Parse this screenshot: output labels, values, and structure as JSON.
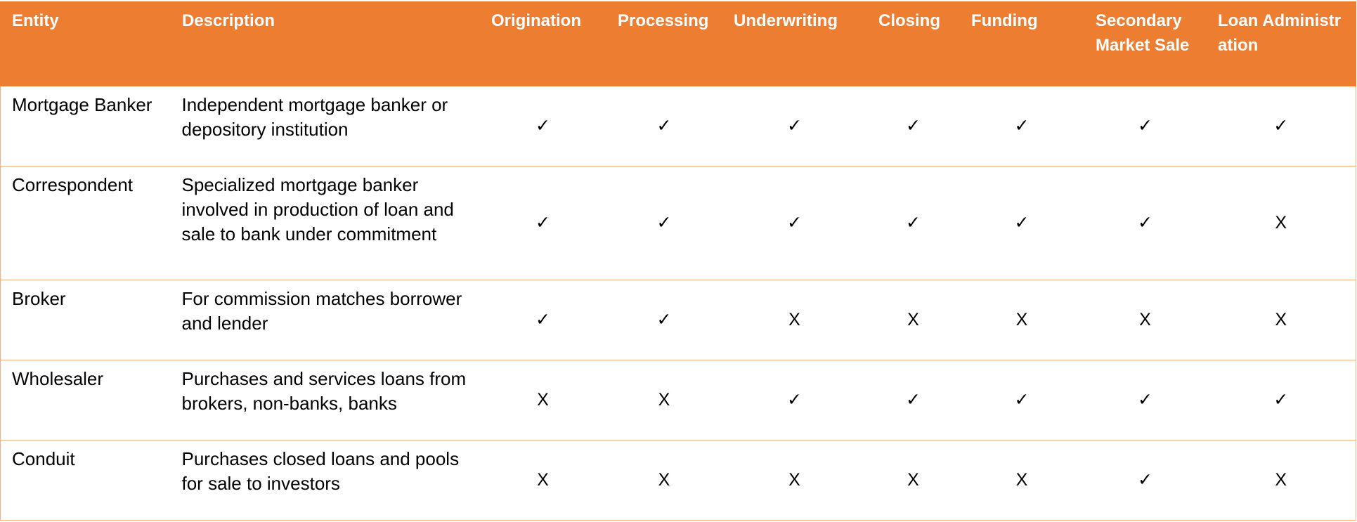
{
  "columns": [
    "Entity",
    "Description",
    "Origination",
    "Processing",
    "Underwriting",
    "Closing",
    "Funding",
    "Secondary Market Sale",
    "Loan Administration"
  ],
  "rows": [
    {
      "entity": "Mortgage Banker",
      "description": "Independent mortgage banker or depository institution",
      "marks": [
        "✓",
        "✓",
        "✓",
        "✓",
        "✓",
        "✓",
        "✓"
      ]
    },
    {
      "entity": "Correspondent",
      "description": "Specialized mortgage banker involved in production of loan and sale to bank under commitment",
      "marks": [
        "✓",
        "✓",
        "✓",
        "✓",
        "✓",
        "✓",
        "X"
      ]
    },
    {
      "entity": "Broker",
      "description": "For commission matches borrower and lender",
      "marks": [
        "✓",
        "✓",
        "X",
        "X",
        "X",
        "X",
        "X"
      ]
    },
    {
      "entity": "Wholesaler",
      "description": "Purchases and services loans from brokers, non-banks, banks",
      "marks": [
        "X",
        "X",
        "✓",
        "✓",
        "✓",
        "✓",
        "✓"
      ]
    },
    {
      "entity": "Conduit",
      "description": "Purchases closed loans and pools for sale to investors",
      "marks": [
        "X",
        "X",
        "X",
        "X",
        "X",
        "✓",
        "X"
      ]
    }
  ],
  "colors": {
    "header_background": "#ed7d31",
    "header_text": "#ffffff",
    "row_border": "#f4b183"
  }
}
